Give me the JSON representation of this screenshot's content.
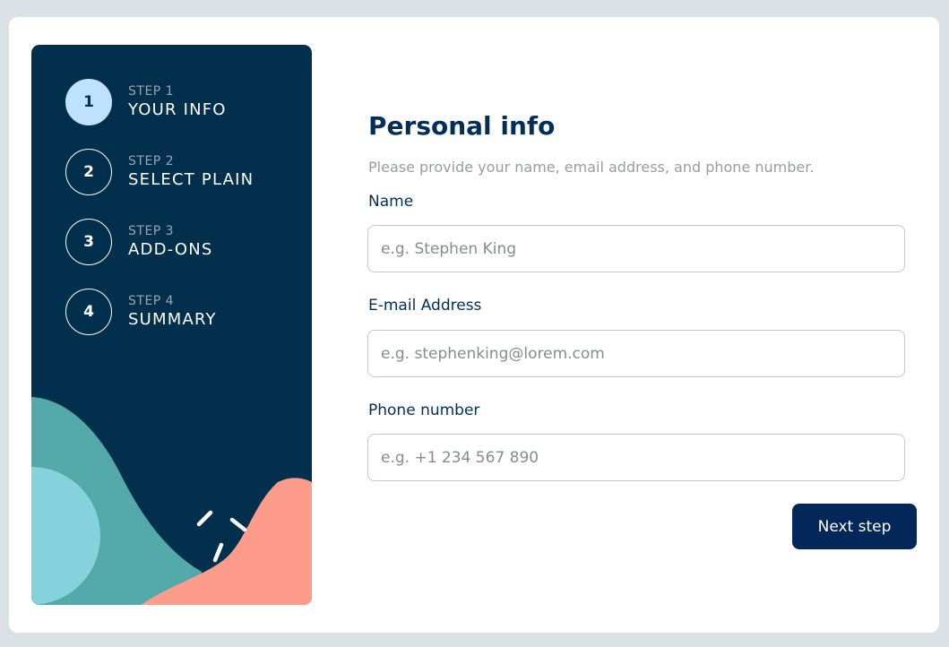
{
  "sidebar": {
    "steps": [
      {
        "number": "1",
        "label": "STEP 1",
        "name": "YOUR INFO"
      },
      {
        "number": "2",
        "label": "STEP 2",
        "name": "SELECT PLAIN"
      },
      {
        "number": "3",
        "label": "STEP 3",
        "name": "ADD-ONS"
      },
      {
        "number": "4",
        "label": "STEP 4",
        "name": "SUMMARY"
      }
    ],
    "active_step": 1
  },
  "form": {
    "title": "Personal info",
    "subtitle": "Please provide your name, email address, and phone number.",
    "fields": {
      "name": {
        "label": "Name",
        "placeholder": "e.g. Stephen King",
        "value": ""
      },
      "email": {
        "label": "E-mail Address",
        "placeholder": "e.g. stephenking@lorem.com",
        "value": ""
      },
      "phone": {
        "label": "Phone number",
        "placeholder": "e.g. +1 234 567 890",
        "value": ""
      }
    },
    "next_label": "Next step"
  },
  "colors": {
    "page_background": "#dbe2e5",
    "sidebar_background": "#022f4c",
    "active_step_fill": "#bee2fd",
    "title": "#022f58",
    "button": "#022758",
    "decor_teal": "#53a9a9",
    "decor_light_blue": "#85d1dc",
    "decor_salmon": "#fe9c8b"
  }
}
